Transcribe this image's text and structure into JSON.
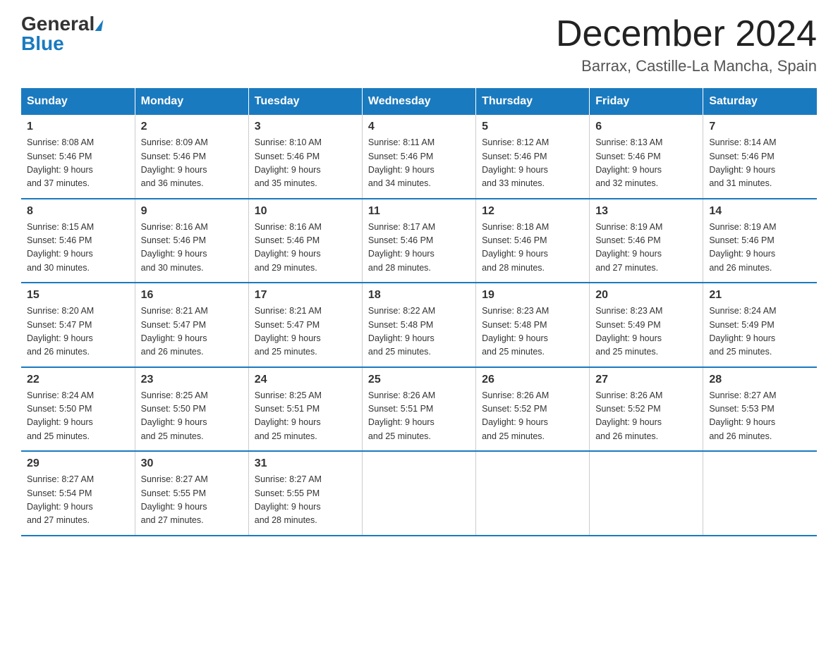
{
  "header": {
    "logo_general": "General",
    "logo_blue": "Blue",
    "month_title": "December 2024",
    "location": "Barrax, Castille-La Mancha, Spain"
  },
  "weekdays": [
    "Sunday",
    "Monday",
    "Tuesday",
    "Wednesday",
    "Thursday",
    "Friday",
    "Saturday"
  ],
  "weeks": [
    [
      {
        "day": "1",
        "sunrise": "8:08 AM",
        "sunset": "5:46 PM",
        "daylight": "9 hours and 37 minutes."
      },
      {
        "day": "2",
        "sunrise": "8:09 AM",
        "sunset": "5:46 PM",
        "daylight": "9 hours and 36 minutes."
      },
      {
        "day": "3",
        "sunrise": "8:10 AM",
        "sunset": "5:46 PM",
        "daylight": "9 hours and 35 minutes."
      },
      {
        "day": "4",
        "sunrise": "8:11 AM",
        "sunset": "5:46 PM",
        "daylight": "9 hours and 34 minutes."
      },
      {
        "day": "5",
        "sunrise": "8:12 AM",
        "sunset": "5:46 PM",
        "daylight": "9 hours and 33 minutes."
      },
      {
        "day": "6",
        "sunrise": "8:13 AM",
        "sunset": "5:46 PM",
        "daylight": "9 hours and 32 minutes."
      },
      {
        "day": "7",
        "sunrise": "8:14 AM",
        "sunset": "5:46 PM",
        "daylight": "9 hours and 31 minutes."
      }
    ],
    [
      {
        "day": "8",
        "sunrise": "8:15 AM",
        "sunset": "5:46 PM",
        "daylight": "9 hours and 30 minutes."
      },
      {
        "day": "9",
        "sunrise": "8:16 AM",
        "sunset": "5:46 PM",
        "daylight": "9 hours and 30 minutes."
      },
      {
        "day": "10",
        "sunrise": "8:16 AM",
        "sunset": "5:46 PM",
        "daylight": "9 hours and 29 minutes."
      },
      {
        "day": "11",
        "sunrise": "8:17 AM",
        "sunset": "5:46 PM",
        "daylight": "9 hours and 28 minutes."
      },
      {
        "day": "12",
        "sunrise": "8:18 AM",
        "sunset": "5:46 PM",
        "daylight": "9 hours and 28 minutes."
      },
      {
        "day": "13",
        "sunrise": "8:19 AM",
        "sunset": "5:46 PM",
        "daylight": "9 hours and 27 minutes."
      },
      {
        "day": "14",
        "sunrise": "8:19 AM",
        "sunset": "5:46 PM",
        "daylight": "9 hours and 26 minutes."
      }
    ],
    [
      {
        "day": "15",
        "sunrise": "8:20 AM",
        "sunset": "5:47 PM",
        "daylight": "9 hours and 26 minutes."
      },
      {
        "day": "16",
        "sunrise": "8:21 AM",
        "sunset": "5:47 PM",
        "daylight": "9 hours and 26 minutes."
      },
      {
        "day": "17",
        "sunrise": "8:21 AM",
        "sunset": "5:47 PM",
        "daylight": "9 hours and 25 minutes."
      },
      {
        "day": "18",
        "sunrise": "8:22 AM",
        "sunset": "5:48 PM",
        "daylight": "9 hours and 25 minutes."
      },
      {
        "day": "19",
        "sunrise": "8:23 AM",
        "sunset": "5:48 PM",
        "daylight": "9 hours and 25 minutes."
      },
      {
        "day": "20",
        "sunrise": "8:23 AM",
        "sunset": "5:49 PM",
        "daylight": "9 hours and 25 minutes."
      },
      {
        "day": "21",
        "sunrise": "8:24 AM",
        "sunset": "5:49 PM",
        "daylight": "9 hours and 25 minutes."
      }
    ],
    [
      {
        "day": "22",
        "sunrise": "8:24 AM",
        "sunset": "5:50 PM",
        "daylight": "9 hours and 25 minutes."
      },
      {
        "day": "23",
        "sunrise": "8:25 AM",
        "sunset": "5:50 PM",
        "daylight": "9 hours and 25 minutes."
      },
      {
        "day": "24",
        "sunrise": "8:25 AM",
        "sunset": "5:51 PM",
        "daylight": "9 hours and 25 minutes."
      },
      {
        "day": "25",
        "sunrise": "8:26 AM",
        "sunset": "5:51 PM",
        "daylight": "9 hours and 25 minutes."
      },
      {
        "day": "26",
        "sunrise": "8:26 AM",
        "sunset": "5:52 PM",
        "daylight": "9 hours and 25 minutes."
      },
      {
        "day": "27",
        "sunrise": "8:26 AM",
        "sunset": "5:52 PM",
        "daylight": "9 hours and 26 minutes."
      },
      {
        "day": "28",
        "sunrise": "8:27 AM",
        "sunset": "5:53 PM",
        "daylight": "9 hours and 26 minutes."
      }
    ],
    [
      {
        "day": "29",
        "sunrise": "8:27 AM",
        "sunset": "5:54 PM",
        "daylight": "9 hours and 27 minutes."
      },
      {
        "day": "30",
        "sunrise": "8:27 AM",
        "sunset": "5:55 PM",
        "daylight": "9 hours and 27 minutes."
      },
      {
        "day": "31",
        "sunrise": "8:27 AM",
        "sunset": "5:55 PM",
        "daylight": "9 hours and 28 minutes."
      },
      null,
      null,
      null,
      null
    ]
  ]
}
